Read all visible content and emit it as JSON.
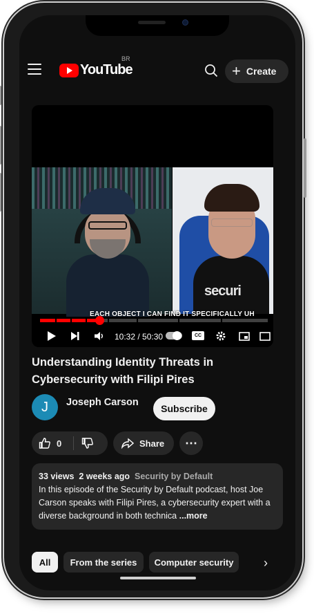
{
  "header": {
    "logo_text": "YouTube",
    "country_code": "BR",
    "create_label": "Create",
    "icons": [
      "hamburger-menu-icon",
      "youtube-logo-icon",
      "search-icon",
      "plus-icon"
    ]
  },
  "video": {
    "caption_text": "EACH OBJECT I CAN FIND IT SPECIFICALLY UH",
    "shirt_text": "securi",
    "current_time": "10:32 / 50:30",
    "progress_fraction": 0.26,
    "controls_icons": [
      "play-icon",
      "skip-next-icon",
      "volume-icon",
      "autoplay-toggle-icon",
      "closed-captions-icon",
      "settings-icon",
      "miniplayer-icon",
      "theater-icon"
    ],
    "cc_label": "CC"
  },
  "title": "Understanding Identity Threats in Cybersecurity with Filipi Pires",
  "channel": {
    "avatar_letter": "J",
    "avatar_color": "#1c8bb5",
    "name": "Joseph Carson",
    "subscribe_label": "Subscribe"
  },
  "actions": {
    "like_count": "0",
    "share_label": "Share",
    "icons": [
      "thumbs-up-icon",
      "thumbs-down-icon",
      "share-icon",
      "more-icon"
    ]
  },
  "description": {
    "views": "33 views",
    "age": "2 weeks ago",
    "source": "Security by Default",
    "text": "In this episode of the Security by Default podcast, host Joe Carson speaks with Filipi Pires, a cybersecurity expert with a diverse background in both technica",
    "more_label": "...more"
  },
  "chips": {
    "items": [
      "All",
      "From the series",
      "Computer security"
    ],
    "active": "All"
  },
  "colors": {
    "background": "#0f0f0f",
    "surface": "#272727",
    "accent": "#ff0000",
    "text": "#f1f1f1"
  }
}
